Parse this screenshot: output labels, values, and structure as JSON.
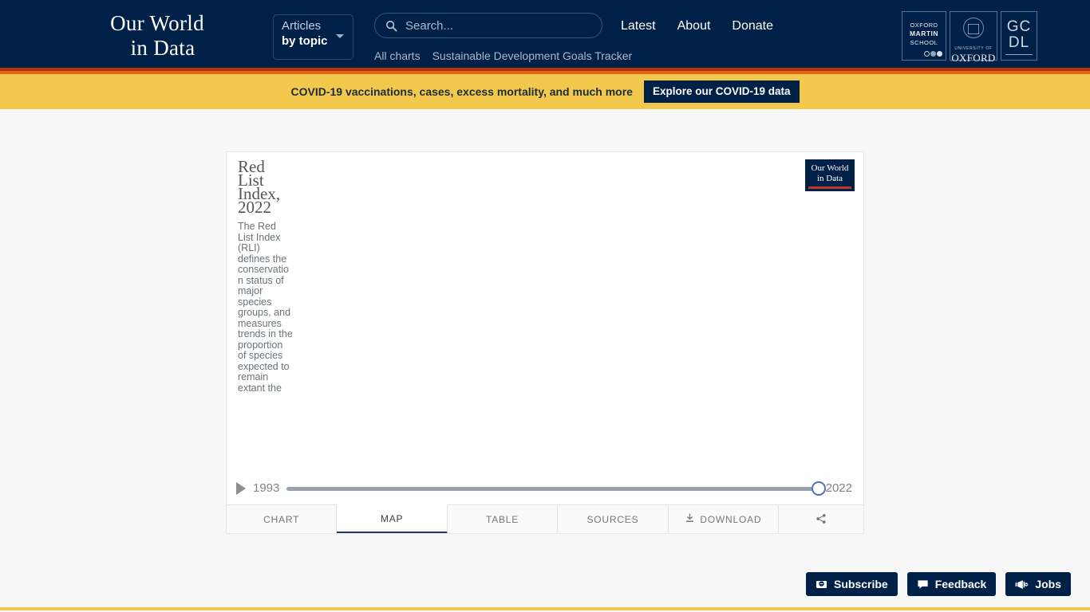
{
  "header": {
    "logo_line_1": "Our World",
    "logo_line_2": "in Data",
    "articles_top": "Articles",
    "articles_bottom": "by topic",
    "search_placeholder": "Search...",
    "nav": [
      {
        "label": "Latest"
      },
      {
        "label": "About"
      },
      {
        "label": "Donate"
      }
    ],
    "subnav": [
      {
        "label": "All charts"
      },
      {
        "label": "Sustainable Development Goals Tracker"
      }
    ],
    "logos": {
      "oms_line_1": "OXFORD",
      "oms_line_2": "MARTIN",
      "oms_line_3": "SCHOOL",
      "uox_sub": "UNIVERSITY OF",
      "uox_name": "OXFORD",
      "gcdl_line_1": "GC",
      "gcdl_line_2": "DL"
    }
  },
  "covid_banner": {
    "text": "COVID-19 vaccinations, cases, excess mortality, and much more",
    "button_label": "Explore our COVID-19 data"
  },
  "chart": {
    "title": "Red List Index, 2022",
    "subtitle": "The Red List Index (RLI) defines the conservation status of major species groups, and measures trends in the proportion of species expected to remain extant the",
    "badge_line_1": "Our World",
    "badge_line_2": "in Data",
    "timeline": {
      "start_year": "1993",
      "end_year": "2022"
    },
    "tabs": [
      {
        "label": "CHART",
        "active": false
      },
      {
        "label": "MAP",
        "active": true
      },
      {
        "label": "TABLE",
        "active": false
      },
      {
        "label": "SOURCES",
        "active": false
      },
      {
        "label": "DOWNLOAD",
        "active": false,
        "icon": "download-icon"
      },
      {
        "label": "",
        "active": false,
        "icon": "share-icon"
      }
    ]
  },
  "float_actions": [
    {
      "label": "Subscribe",
      "icon": "envelope-icon"
    },
    {
      "label": "Feedback",
      "icon": "speech-bubble-icon"
    },
    {
      "label": "Jobs",
      "icon": "megaphone-icon"
    }
  ],
  "colors": {
    "navy": "#002147",
    "yellow": "#f2c94c",
    "orange": "#e56317",
    "red": "#b13507",
    "page_bg": "#f7f7f7",
    "accent_blue": "#4b74b5"
  }
}
